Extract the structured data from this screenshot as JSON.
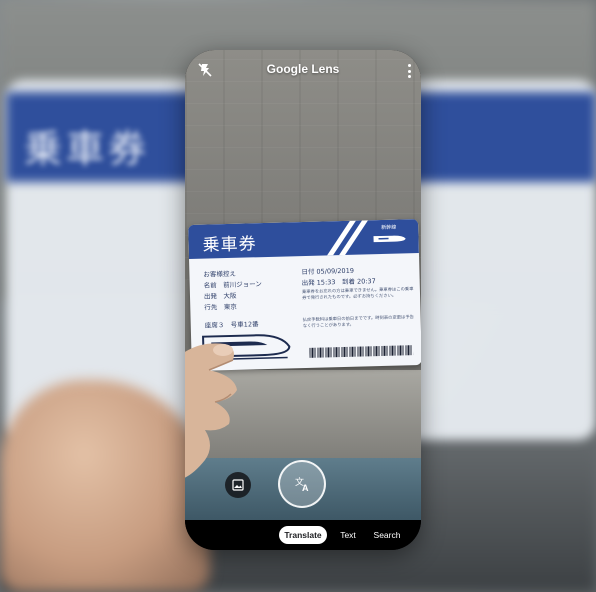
{
  "app": {
    "title": "Google Lens"
  },
  "ticket": {
    "title": "乗車券",
    "badge": "新幹線",
    "name_label": "お客様控え",
    "name_line": "名前　前川ジョーン",
    "from_line": "出発　大阪",
    "to_line": "行先　東京",
    "seat_line": "座席３　号車12番",
    "date_line": "日付 05/09/2019",
    "time_line": "出発 15:33　到着 20:37",
    "body_text_1": "乗車券をお忘れの方は乗車できません。乗車券はこの乗車券で発行されたものです。必ずお持ちください。",
    "body_text_2": "払戻手数料は乗車日の前日までです。時刻表の変更は予告なく行うことがあります。"
  },
  "modes": {
    "translate": "Translate",
    "text": "Text",
    "search": "Search",
    "active": "translate"
  },
  "icons": {
    "flash": "flash-off-icon",
    "more": "more-vert-icon",
    "gallery": "image-icon",
    "shutter": "translate-icon"
  },
  "colors": {
    "ticket_band": "#2e4e9c",
    "active_tab_bg": "#ffffff"
  }
}
